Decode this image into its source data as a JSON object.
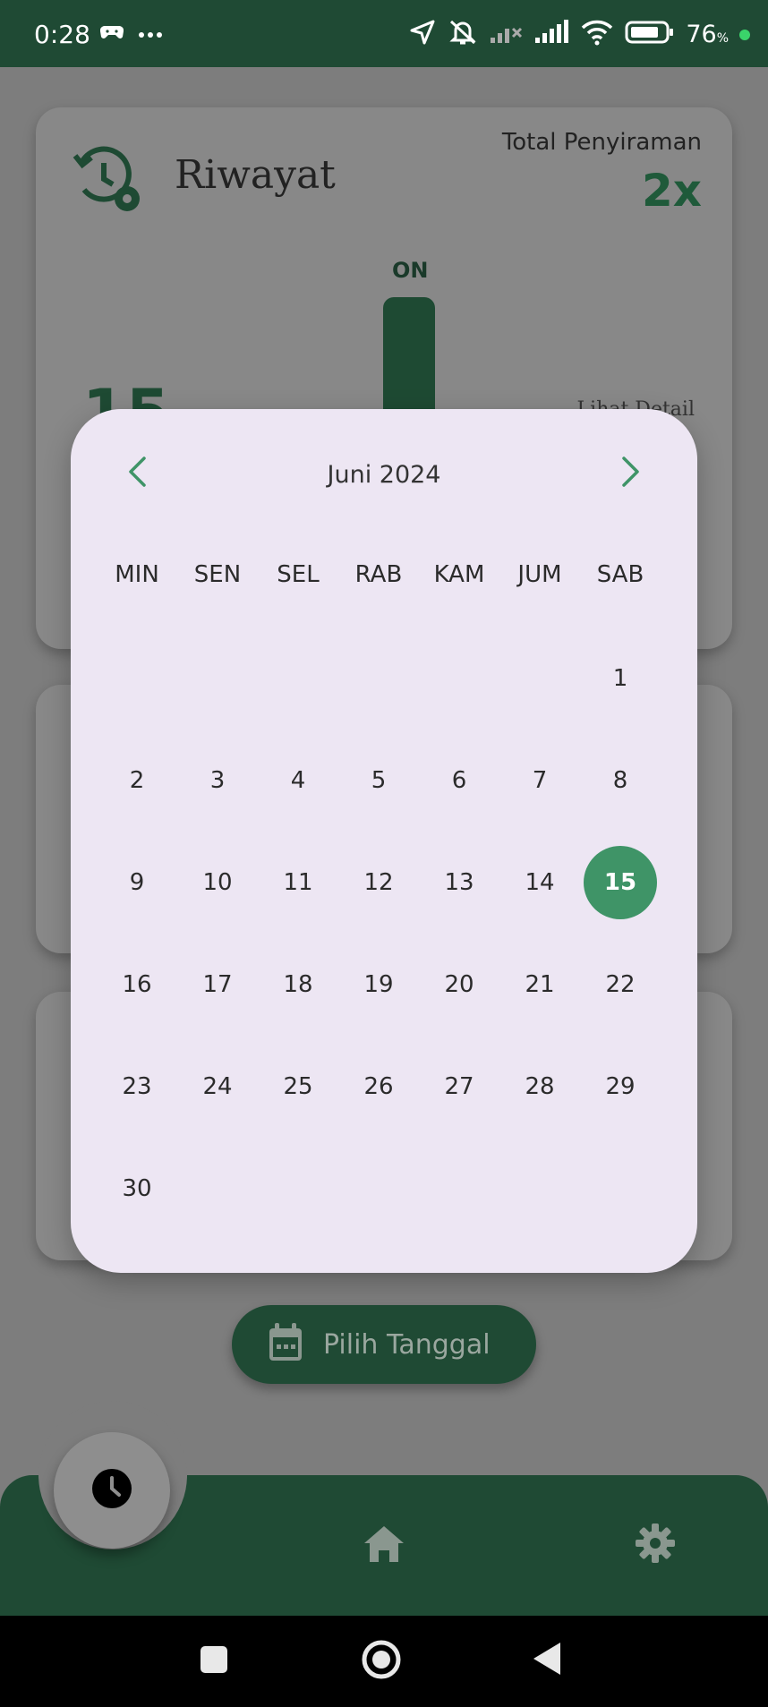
{
  "status_bar": {
    "time": "0:28",
    "battery_percent": "76",
    "battery_unit": "%",
    "icons": [
      "game-controller-icon",
      "more-dots-icon",
      "location-arrow-icon",
      "bell-muted-icon",
      "signal-off-icon",
      "signal-icon",
      "wifi-icon",
      "battery-icon"
    ]
  },
  "history_card": {
    "title": "Riwayat",
    "total_label": "Total Penyiraman",
    "total_value": "2x",
    "bar_label": "ON",
    "big_number": "15",
    "detail_link": "Lihat Detail"
  },
  "date_picker": {
    "month_title": "Juni 2024",
    "weekdays": [
      "MIN",
      "SEN",
      "SEL",
      "RAB",
      "KAM",
      "JUM",
      "SAB"
    ],
    "days": [
      "",
      "",
      "",
      "",
      "",
      "",
      "1",
      "2",
      "3",
      "4",
      "5",
      "6",
      "7",
      "8",
      "9",
      "10",
      "11",
      "12",
      "13",
      "14",
      "15",
      "16",
      "17",
      "18",
      "19",
      "20",
      "21",
      "22",
      "23",
      "24",
      "25",
      "26",
      "27",
      "28",
      "29",
      "30",
      "",
      "",
      "",
      "",
      "",
      ""
    ],
    "selected_day": "15"
  },
  "pick_date_button": {
    "label": "Pilih Tanggal"
  },
  "colors": {
    "primary_green": "#1f4a34",
    "accent_green": "#3f9467",
    "dialog_bg": "#ede6f3"
  }
}
